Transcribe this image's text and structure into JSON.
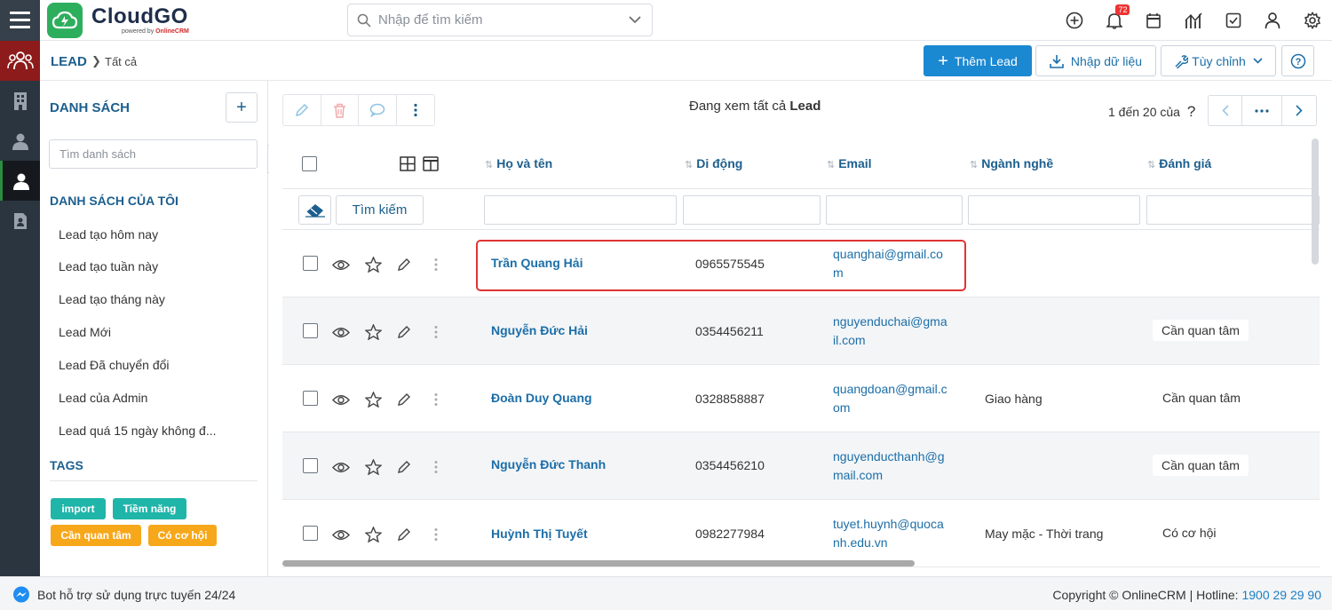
{
  "app": {
    "name": "CloudGO",
    "sub_prefix": "powered by ",
    "sub_brand": "OnlineCRM"
  },
  "search": {
    "placeholder": "Nhập để tìm kiếm"
  },
  "notifications": {
    "count": "72"
  },
  "top_icons": [
    "plus-circle-icon",
    "bell-icon",
    "calendar-icon",
    "chart-icon",
    "checkbox-icon",
    "user-icon",
    "gear-icon"
  ],
  "breadcrumb": {
    "module": "LEAD",
    "current": "Tất cả"
  },
  "actions": {
    "add": "Thêm Lead",
    "import": "Nhập dữ liệu",
    "customize": "Tùy chỉnh",
    "help": "?"
  },
  "sidebar": {
    "lists_title": "DANH SÁCH",
    "search_placeholder": "Tìm danh sách",
    "my_lists_title": "DANH SÁCH CỦA TÔI",
    "items": [
      "Lead tạo hôm nay",
      "Lead tạo tuần này",
      "Lead tạo tháng này",
      "Lead Mới",
      "Lead Đã chuyển đổi",
      "Lead của Admin",
      "Lead quá 15 ngày không đ..."
    ],
    "tags_title": "TAGS",
    "tags": [
      {
        "label": "import",
        "color": "#1fb5a9"
      },
      {
        "label": "Tiềm năng",
        "color": "#1fb5a9"
      },
      {
        "label": "Cần quan tâm",
        "color": "#f7a71a"
      },
      {
        "label": "Có cơ hội",
        "color": "#f7a71a"
      }
    ]
  },
  "main": {
    "viewing_prefix": "Đang xem tất cả",
    "viewing_module": "Lead",
    "page_info": "1 đến 20 của",
    "page_unknown": "?",
    "search_button": "Tìm kiếm",
    "columns": [
      "Họ và tên",
      "Di động",
      "Email",
      "Ngành nghề",
      "Đánh giá"
    ],
    "rows": [
      {
        "name": "Trần Quang Hải",
        "mobile": "0965575545",
        "email": [
          "quanghai@gmail.co",
          "m"
        ],
        "industry": "",
        "rating": ""
      },
      {
        "name": "Nguyễn Đức Hải",
        "mobile": "0354456211",
        "email": [
          "nguyenduchai@gma",
          "il.com"
        ],
        "industry": "",
        "rating": "Cần quan tâm"
      },
      {
        "name": "Đoàn Duy Quang",
        "mobile": "0328858887",
        "email": [
          "quangdoan@gmail.c",
          "om"
        ],
        "industry": "Giao hàng",
        "rating": "Cần quan tâm"
      },
      {
        "name": "Nguyễn Đức Thanh",
        "mobile": "0354456210",
        "email": [
          "nguyenducthanh@g",
          "mail.com"
        ],
        "industry": "",
        "rating": "Cần quan tâm"
      },
      {
        "name": "Huỳnh Thị Tuyết",
        "mobile": "0982277984",
        "email": [
          "tuyet.huynh@quoca",
          "nh.edu.vn"
        ],
        "industry": "May mặc - Thời trang",
        "rating": "Có cơ hội"
      }
    ]
  },
  "footer": {
    "bot_text": "Bot hỗ trợ sử dụng trực tuyến 24/24",
    "copyright": "Copyright © OnlineCRM | Hotline: ",
    "hotline": "1900 29 29 90"
  }
}
